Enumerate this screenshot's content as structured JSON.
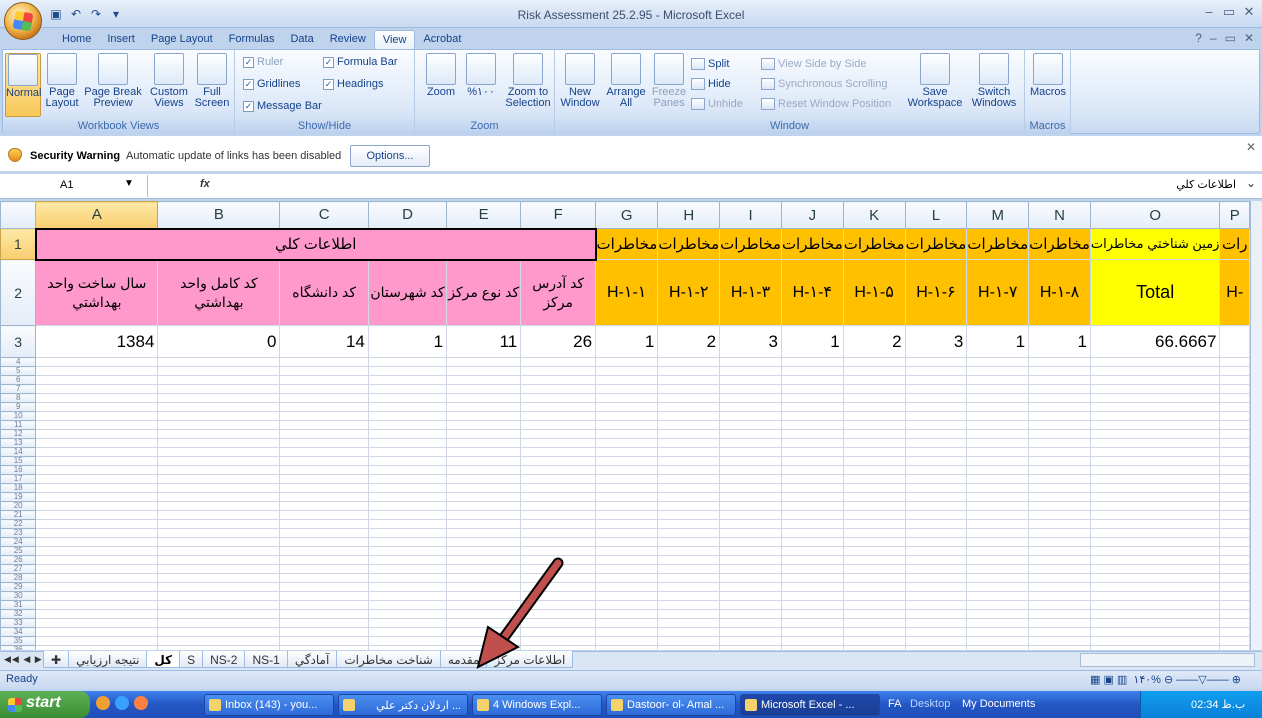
{
  "window": {
    "title": "Risk Assessment 25.2.95 - Microsoft Excel"
  },
  "ribbon_tabs": [
    "Home",
    "Insert",
    "Page Layout",
    "Formulas",
    "Data",
    "Review",
    "View",
    "Acrobat"
  ],
  "ribbon": {
    "workbook_views": {
      "label": "Workbook Views",
      "normal": "Normal",
      "page_layout_1": "Page",
      "page_layout_2": "Layout",
      "page_break_1": "Page Break",
      "page_break_2": "Preview",
      "custom_1": "Custom",
      "custom_2": "Views",
      "full_1": "Full",
      "full_2": "Screen"
    },
    "show_hide": {
      "label": "Show/Hide",
      "ruler": "Ruler",
      "gridlines": "Gridlines",
      "message_bar": "Message Bar",
      "formula_bar": "Formula Bar",
      "headings": "Headings"
    },
    "zoom": {
      "label": "Zoom",
      "zoom": "Zoom",
      "hundred": "%۱۰۰",
      "zoom_sel_1": "Zoom to",
      "zoom_sel_2": "Selection"
    },
    "window": {
      "label": "Window",
      "new_1": "New",
      "new_2": "Window",
      "arrange_1": "Arrange",
      "arrange_2": "All",
      "freeze_1": "Freeze",
      "freeze_2": "Panes",
      "split": "Split",
      "hide": "Hide",
      "unhide": "Unhide",
      "side_by_side": "View Side by Side",
      "sync_scroll": "Synchronous Scrolling",
      "reset_pos": "Reset Window Position",
      "save_1": "Save",
      "save_2": "Workspace",
      "switch_1": "Switch",
      "switch_2": "Windows"
    },
    "macros": {
      "label": "Macros",
      "macros": "Macros"
    }
  },
  "security": {
    "title": "Security Warning",
    "message": "Automatic update of links has been disabled",
    "options": "Options..."
  },
  "formula_bar": {
    "name_box": "A1",
    "fx": "fx",
    "content": "اطلاعات کلي"
  },
  "columns": [
    "A",
    "B",
    "C",
    "D",
    "E",
    "F",
    "G",
    "H",
    "I",
    "J",
    "K",
    "L",
    "M",
    "N",
    "O",
    "P"
  ],
  "row1": {
    "merged_label": "اطلاعات کلي",
    "risk": "مخاطرات",
    "o": "زمين شناختي مخاطرات",
    "p": "رات"
  },
  "row2": {
    "A": "سال ساخت واحد بهداشتي",
    "B": "كد كامل واحد بهداشتي",
    "C": "كد دانشگاه",
    "D": "كد شهرستان",
    "E": "كد نوع مركز",
    "F": "كد آدرس مركز",
    "G": "H-۱-۱",
    "H": "H-۱-۲",
    "I": "H-۱-۳",
    "J": "H-۱-۴",
    "K": "H-۱-۵",
    "L": "H-۱-۶",
    "M": "H-۱-۷",
    "N": "H-۱-۸",
    "O": "Total",
    "P": "H-"
  },
  "row3": {
    "A": "1384",
    "B": "0",
    "C": "14",
    "D": "1",
    "E": "11",
    "F": "26",
    "G": "1",
    "H": "2",
    "I": "3",
    "J": "1",
    "K": "2",
    "L": "3",
    "M": "1",
    "N": "1",
    "O": "66.6667"
  },
  "sheet_tabs": [
    "اطلاعات مركز",
    "مقدمه",
    "شناخت مخاطرات",
    "آمادگي",
    "NS-1",
    "NS-2",
    "S",
    "كل",
    "نتيجه ارزيابي"
  ],
  "active_sheet": "كل",
  "status": {
    "ready": "Ready",
    "zoom": "۱۴۰%"
  },
  "taskbar": {
    "start": "start",
    "buttons": [
      "Inbox (143) - you...",
      "... اردلان دكتر علي",
      "4 Windows Expl...",
      "Dastoor- ol- Amal ...",
      "Microsoft Excel - ..."
    ],
    "fa": "FA",
    "desktop": "Desktop",
    "my_documents": "My Documents",
    "clock": "02:34 ب.ظ"
  }
}
